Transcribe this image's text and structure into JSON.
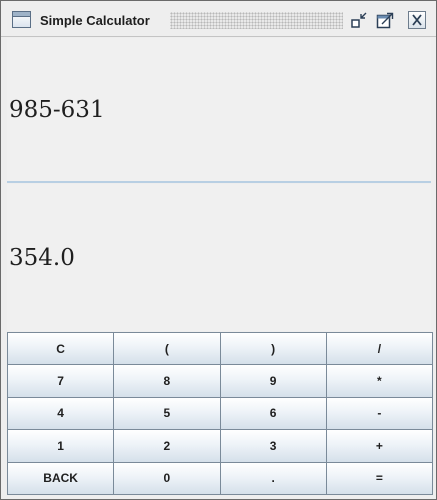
{
  "window": {
    "title": "Simple Calculator",
    "icons": {
      "app": "window-icon",
      "iconify": "iconify-icon",
      "maximize": "maximize-icon",
      "close": "close-icon"
    }
  },
  "display": {
    "expression": "985-631",
    "result": "354.0"
  },
  "keypad": {
    "rows": [
      [
        "C",
        "(",
        ")",
        "/"
      ],
      [
        "7",
        "8",
        "9",
        "*"
      ],
      [
        "4",
        "5",
        "6",
        "-"
      ],
      [
        "1",
        "2",
        "3",
        "+"
      ],
      [
        "BACK",
        "0",
        ".",
        "="
      ]
    ]
  },
  "colors": {
    "divider": "#b8cfe3",
    "button_border": "#7a8a99",
    "background": "#eeeeee"
  }
}
